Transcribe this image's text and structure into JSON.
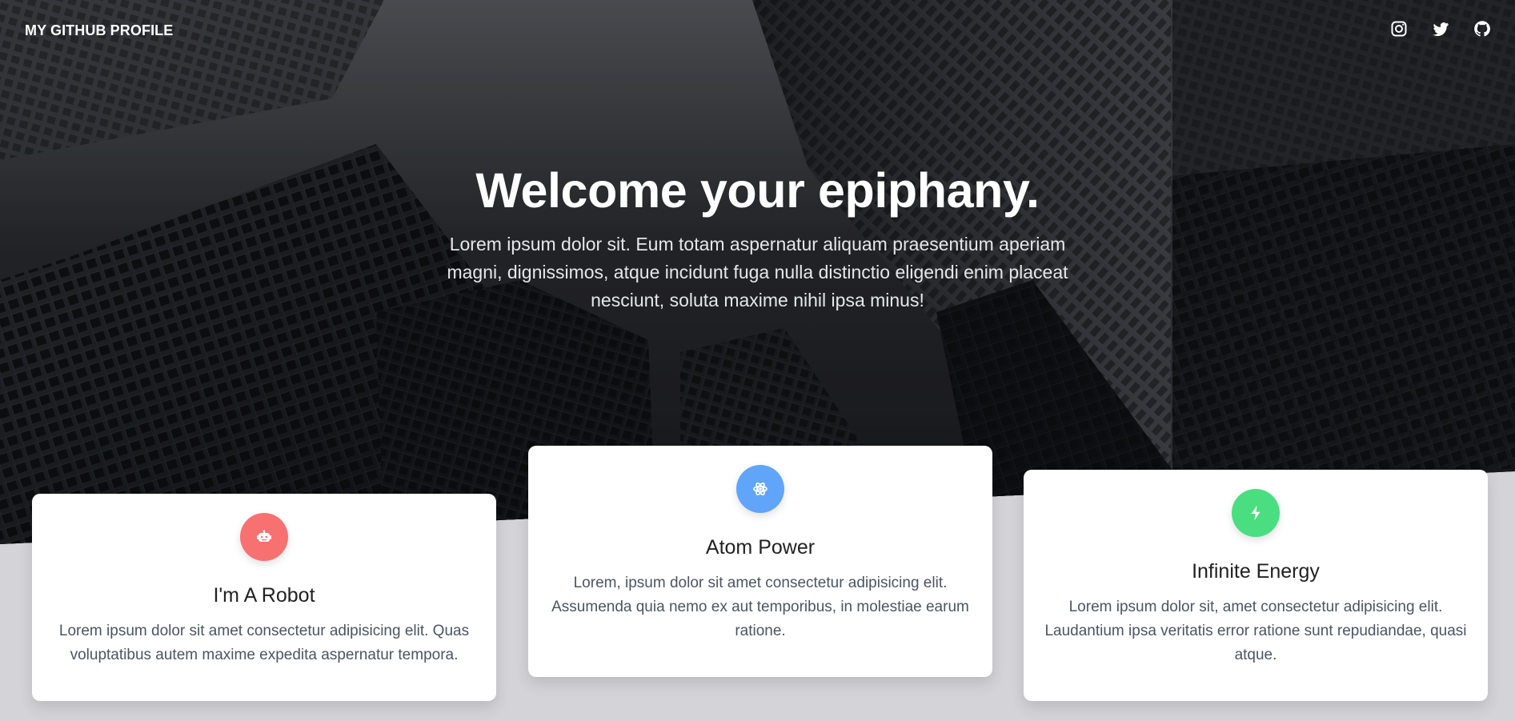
{
  "site": {
    "brand": "MY GITHUB PROFILE"
  },
  "social": [
    {
      "name": "instagram-icon"
    },
    {
      "name": "twitter-icon"
    },
    {
      "name": "github-icon"
    }
  ],
  "hero": {
    "title": "Welcome your epiphany.",
    "text": "Lorem ipsum dolor sit. Eum totam aspernatur aliquam praesentium aperiam magni, dignissimos, atque incidunt fuga nulla distinctio eligendi enim placeat nesciunt, soluta maxime nihil ipsa minus!"
  },
  "cards": [
    {
      "title": "I'm A Robot",
      "text": "Lorem ipsum dolor sit amet consectetur adipisicing elit. Quas voluptatibus autem maxime expedita aspernatur tempora.",
      "icon": "robot-icon",
      "color": "#f87171"
    },
    {
      "title": "Atom Power",
      "text": "Lorem, ipsum dolor sit amet consectetur adipisicing elit. Assumenda quia nemo ex aut temporibus, in molestiae earum ratione.",
      "icon": "atom-icon",
      "color": "#60a5fa"
    },
    {
      "title": "Infinite Energy",
      "text": "Lorem ipsum dolor sit, amet consectetur adipisicing elit. Laudantium ipsa veritatis error ratione sunt repudiandae, quasi atque.",
      "icon": "bolt-icon",
      "color": "#4ade80"
    }
  ],
  "colors": {
    "page_bg": "#d4d4d8",
    "card_bg": "#ffffff",
    "hero_text": "#ffffff"
  }
}
